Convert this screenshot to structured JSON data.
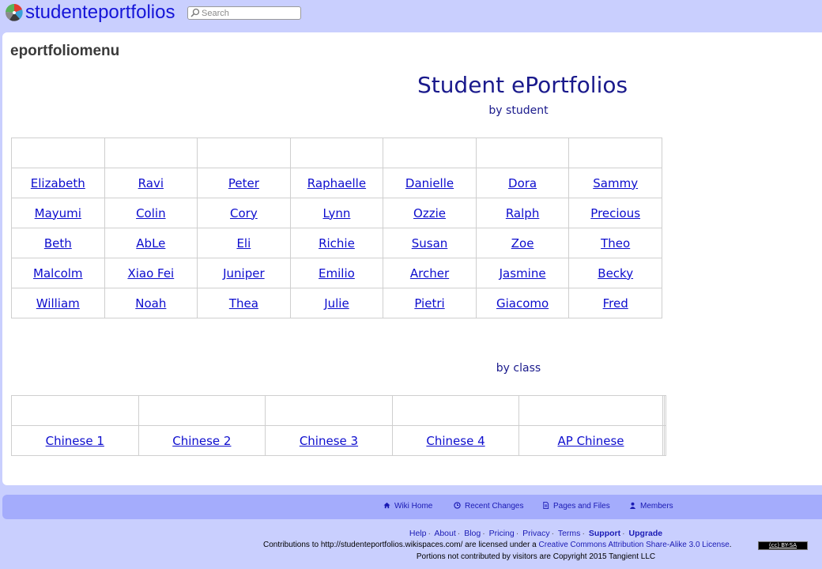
{
  "header": {
    "site_name": "studenteportfolios",
    "search_placeholder": "Search"
  },
  "page": {
    "title": "eportfoliomenu",
    "heading": "Student ePortfolios",
    "by_student_label": "by student",
    "by_class_label": "by class"
  },
  "students": [
    [
      "",
      "",
      "",
      "",
      "",
      "",
      ""
    ],
    [
      "Elizabeth",
      "Ravi",
      "Peter",
      "Raphaelle",
      "Danielle",
      "Dora",
      "Sammy"
    ],
    [
      "Mayumi",
      "Colin",
      "Cory",
      "Lynn",
      "Ozzie",
      "Ralph",
      "Precious"
    ],
    [
      "Beth",
      "AbLe",
      "Eli",
      "Richie",
      "Susan",
      "Zoe",
      "Theo"
    ],
    [
      "Malcolm",
      "Xiao Fei",
      "Juniper",
      "Emilio",
      "Archer",
      "Jasmine",
      "Becky"
    ],
    [
      "William",
      "Noah",
      "Thea",
      "Julie",
      "Pietri",
      "Giacomo",
      "Fred"
    ]
  ],
  "classes": [
    [
      "",
      "",
      "",
      "",
      "",
      "",
      ""
    ],
    [
      "Chinese 1",
      "Chinese 2",
      "Chinese 3",
      "Chinese 4",
      "AP Chinese",
      "",
      ""
    ]
  ],
  "footer_nav": {
    "wiki_home": "Wiki Home",
    "recent_changes": "Recent Changes",
    "pages_and_files": "Pages and Files",
    "members": "Members"
  },
  "footer_links": {
    "help": "Help",
    "about": "About",
    "blog": "Blog",
    "pricing": "Pricing",
    "privacy": "Privacy",
    "terms": "Terms",
    "support": "Support",
    "upgrade": "Upgrade"
  },
  "license": {
    "prefix": "Contributions to http://studenteportfolios.wikispaces.com/ are licensed under a ",
    "link": "Creative Commons Attribution Share-Alike 3.0 License",
    "suffix": ".",
    "badge": "(cc) BY-SA"
  },
  "copyright": "Portions not contributed by visitors are Copyright 2015 Tangient LLC",
  "colors": {
    "background": "#c9cffe",
    "footer_bar": "#a4acfc",
    "link": "#0d0dce",
    "heading": "#1a1a8c"
  }
}
